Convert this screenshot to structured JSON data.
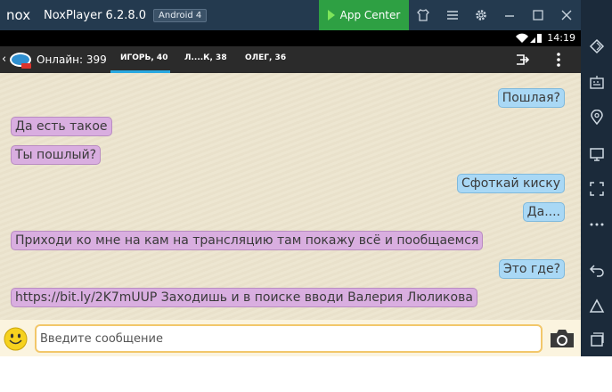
{
  "window": {
    "app_title": "NoxPlayer 6.2.8.0",
    "android_badge": "Android 4",
    "app_center_label": "App Center",
    "logo_text": "nox"
  },
  "statusbar": {
    "time": "14:19"
  },
  "chat_header": {
    "online_label": "Онлайн: 399",
    "tabs": [
      {
        "label": "ИГОРЬ, 40",
        "active": true
      },
      {
        "label": "Л....К, 38",
        "active": false
      },
      {
        "label": "ОЛЕГ, 36",
        "active": false
      }
    ]
  },
  "messages": [
    {
      "text": "Пошлая?",
      "side": "out"
    },
    {
      "text": "Да есть такое",
      "side": "in"
    },
    {
      "text": "Ты пошлый?",
      "side": "in"
    },
    {
      "text": "Сфоткай киску",
      "side": "out"
    },
    {
      "text": "Да....",
      "side": "out"
    },
    {
      "text": "Приходи ко мне на кам на трансляцию там покажу всё и пообщаемся",
      "side": "in"
    },
    {
      "text": "Это где?",
      "side": "out"
    },
    {
      "text": "https://bit.ly/2K7mUUP Заходишь и в поиске вводи Валерия Люликова",
      "side": "in"
    }
  ],
  "input": {
    "placeholder": "Введите сообщение",
    "value": ""
  },
  "colors": {
    "titlebar": "#243a4f",
    "app_center": "#2ea043",
    "sidebar": "#1b2a3a",
    "incoming_bubble": "#d9aee0",
    "outgoing_bubble": "#a9d8f5",
    "tab_active": "#29a8e0"
  },
  "icons": {
    "titlebar": [
      "shirt-icon",
      "menu-icon",
      "gear-icon",
      "minimize-icon",
      "maximize-icon",
      "close-icon",
      "collapse-icon"
    ],
    "sidebar": [
      "rotate-icon",
      "keyboard-icon",
      "location-icon",
      "screen-icon",
      "fullscreen-icon",
      "more-icon",
      "back-icon",
      "home-icon",
      "recent-apps-icon"
    ]
  }
}
